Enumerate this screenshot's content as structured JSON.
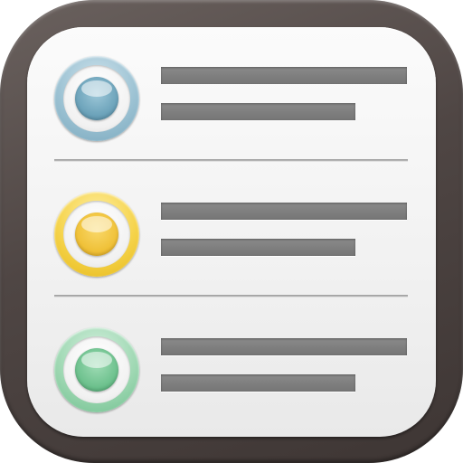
{
  "app": {
    "icon_name": "reminders-icon",
    "frame_color": "#4f4644",
    "paper_color": "#f2f2f2"
  },
  "reminders": [
    {
      "checkbox_color": "#7aa8bd",
      "line_color": "#7a7a7a",
      "checked": false
    },
    {
      "checkbox_color": "#f0c23a",
      "line_color": "#7a7a7a",
      "checked": false
    },
    {
      "checkbox_color": "#6fc28f",
      "line_color": "#7a7a7a",
      "checked": false
    }
  ]
}
